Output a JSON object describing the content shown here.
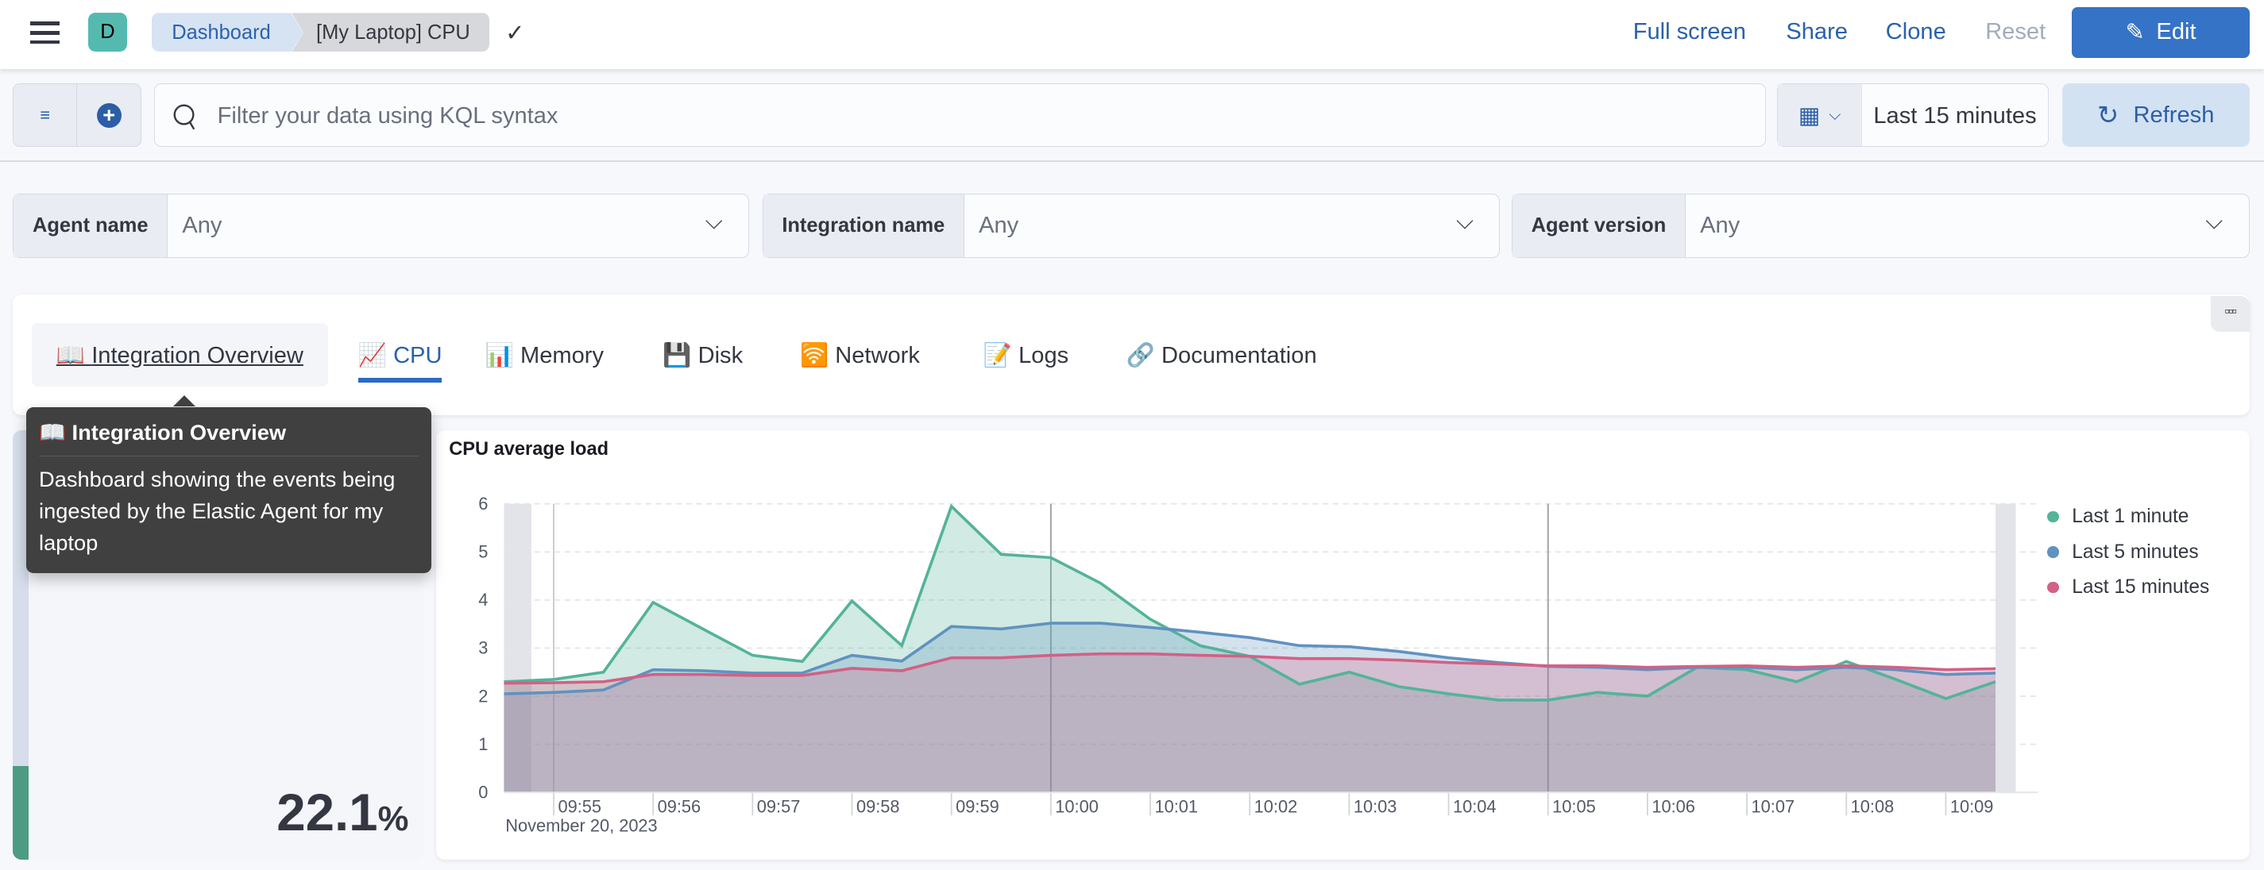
{
  "header": {
    "avatar": "D",
    "breadcrumbs": [
      "Dashboard",
      "[My Laptop] CPU"
    ],
    "actions": {
      "fullscreen": "Full screen",
      "share": "Share",
      "clone": "Clone",
      "reset": "Reset",
      "edit": "Edit"
    }
  },
  "query": {
    "placeholder": "Filter your data using KQL syntax",
    "time_range": "Last 15 minutes",
    "refresh": "Refresh"
  },
  "controls": [
    {
      "label": "Agent name",
      "value": "Any"
    },
    {
      "label": "Integration name",
      "value": "Any"
    },
    {
      "label": "Agent version",
      "value": "Any"
    }
  ],
  "tabs": [
    {
      "icon": "📖",
      "label": "Integration Overview"
    },
    {
      "icon": "📈",
      "label": "CPU",
      "selected": true
    },
    {
      "icon": "📊",
      "label": "Memory"
    },
    {
      "icon": "💾",
      "label": "Disk"
    },
    {
      "icon": "🛜",
      "label": "Network"
    },
    {
      "icon": "📝",
      "label": "Logs"
    },
    {
      "icon": "🔗",
      "label": "Documentation"
    }
  ],
  "tooltip": {
    "title": "📖 Integration Overview",
    "body": "Dashboard showing the events being ingested by the Elastic Agent for my laptop"
  },
  "metric": {
    "value": "22.1",
    "unit": "%",
    "colors": {
      "bar": "#4e9b84"
    }
  },
  "chart_data": {
    "type": "area",
    "title": "CPU average load",
    "date_label": "November 20, 2023",
    "ylim": [
      0,
      6
    ],
    "yticks": [
      0,
      1,
      2,
      3,
      4,
      5,
      6
    ],
    "xticks": [
      "09:55",
      "09:56",
      "09:57",
      "09:58",
      "09:59",
      "10:00",
      "10:01",
      "10:02",
      "10:03",
      "10:04",
      "10:05",
      "10:06",
      "10:07",
      "10:08",
      "10:09"
    ],
    "x": [
      "09:54:30",
      "09:55:00",
      "09:55:30",
      "09:56:00",
      "09:56:30",
      "09:57:00",
      "09:57:30",
      "09:58:00",
      "09:58:30",
      "09:59:00",
      "09:59:30",
      "10:00:00",
      "10:00:30",
      "10:01:00",
      "10:01:30",
      "10:02:00",
      "10:02:30",
      "10:03:00",
      "10:03:30",
      "10:04:00",
      "10:04:30",
      "10:05:00",
      "10:05:30",
      "10:06:00",
      "10:06:30",
      "10:07:00",
      "10:07:30",
      "10:08:00",
      "10:08:30",
      "10:09:00",
      "10:09:30"
    ],
    "grid": true,
    "legend_position": "right",
    "series": [
      {
        "name": "Last 1 minute",
        "color": "#54B399",
        "values": [
          2.3,
          2.35,
          2.5,
          3.95,
          3.4,
          2.85,
          2.72,
          3.98,
          3.05,
          5.95,
          4.95,
          4.88,
          4.35,
          3.6,
          3.05,
          2.83,
          2.25,
          2.5,
          2.2,
          2.05,
          1.92,
          1.92,
          2.08,
          2.0,
          2.6,
          2.55,
          2.3,
          2.72,
          2.35,
          1.95,
          2.3
        ]
      },
      {
        "name": "Last 5 minutes",
        "color": "#6092C0",
        "values": [
          2.05,
          2.08,
          2.13,
          2.55,
          2.53,
          2.48,
          2.48,
          2.85,
          2.73,
          3.45,
          3.4,
          3.52,
          3.52,
          3.43,
          3.33,
          3.22,
          3.05,
          3.03,
          2.93,
          2.8,
          2.7,
          2.62,
          2.6,
          2.55,
          2.6,
          2.6,
          2.55,
          2.6,
          2.55,
          2.45,
          2.48
        ]
      },
      {
        "name": "Last 15 minutes",
        "color": "#D36086",
        "values": [
          2.27,
          2.28,
          2.3,
          2.45,
          2.45,
          2.43,
          2.43,
          2.58,
          2.53,
          2.8,
          2.8,
          2.85,
          2.88,
          2.88,
          2.85,
          2.83,
          2.78,
          2.78,
          2.75,
          2.7,
          2.67,
          2.63,
          2.63,
          2.6,
          2.62,
          2.63,
          2.6,
          2.63,
          2.6,
          2.55,
          2.57
        ]
      }
    ]
  }
}
